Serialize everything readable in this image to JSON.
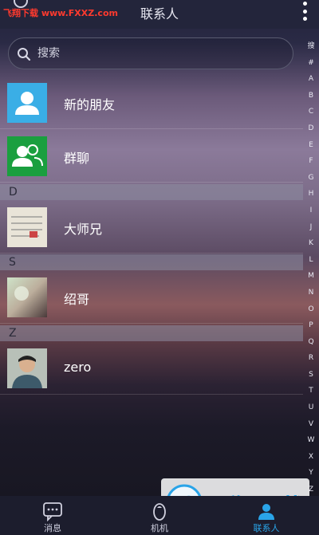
{
  "header": {
    "title": "联系人",
    "watermark": "飞翔下载 www.FXXZ.com"
  },
  "search": {
    "placeholder": "搜索"
  },
  "fixed_items": [
    {
      "name": "新的朋友",
      "icon": "new-friend-icon",
      "color": "#3aaee6"
    },
    {
      "name": "群聊",
      "icon": "group-chat-icon",
      "color": "#1a9f3f"
    }
  ],
  "sections": [
    {
      "letter": "D",
      "contacts": [
        {
          "name": "大师兄"
        }
      ]
    },
    {
      "letter": "S",
      "contacts": [
        {
          "name": "绍哥"
        }
      ]
    },
    {
      "letter": "Z",
      "contacts": [
        {
          "name": "zero"
        }
      ]
    }
  ],
  "alphabet": [
    "搜",
    "#",
    "A",
    "B",
    "C",
    "D",
    "E",
    "F",
    "G",
    "H",
    "I",
    "J",
    "K",
    "L",
    "M",
    "N",
    "O",
    "P",
    "Q",
    "R",
    "S",
    "T",
    "U",
    "V",
    "W",
    "X",
    "Y",
    "Z"
  ],
  "bottom_nav": [
    {
      "label": "消息",
      "icon": "message-icon",
      "active": false
    },
    {
      "label": "机机",
      "icon": "robot-icon",
      "active": false
    },
    {
      "label": "联系人",
      "icon": "contacts-icon",
      "active": true
    }
  ],
  "watermark_logo": {
    "text": "飞翔下载"
  },
  "colors": {
    "active": "#2aa4e8",
    "header_bg": "#23253b"
  }
}
